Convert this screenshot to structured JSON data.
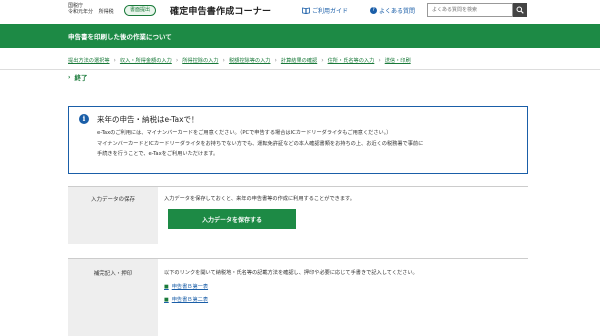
{
  "header": {
    "org_name": "国税庁",
    "year": "令和元年分",
    "tax_type": "所得税",
    "mode_badge": "書面提出",
    "site_title": "確定申告書作成コーナー",
    "guide_link": "ご利用ガイド",
    "faq_link": "よくある質問",
    "search_placeholder": "よくある質問を検索"
  },
  "banner": {
    "title": "申告書を印刷した後の作業について"
  },
  "steps": [
    "提出方法の選択等",
    "収入・所得金額の入力",
    "所得控除の入力",
    "税額控除等の入力",
    "計算結果の確認",
    "住所・氏名等の入力",
    "送信・印刷"
  ],
  "current_step": "終了",
  "info": {
    "title": "来年の申告・納税はe-Taxで！",
    "line1": "e-Taxのご利用には、マイナンバーカードをご用意ください。（PCで申告する場合はICカードリーダライタもご用意ください。）",
    "line2": "マイナンバーカードとICカードリーダライタをお持ちでない方でも、運転免許証などの本人確認書類をお持ちの上、お近くの税務署で事前に",
    "line3": "手続きを行うことで、e-Taxをご利用いただけます。"
  },
  "sections": {
    "save": {
      "label": "入力データの保存",
      "description": "入力データを保存しておくと、来年の申告書等の作成に利用することができます。",
      "button": "入力データを保存する"
    },
    "fill": {
      "label": "補完記入・押印",
      "description": "以下のリンクを開いて納税地・氏名等の記載方法を確認し、押印や必要に応じて手書きで記入してください。",
      "links": [
        "申告書Ｂ第一表",
        "申告書Ｂ第二表"
      ]
    }
  },
  "colors": {
    "brand_green": "#1d8a45",
    "link_blue": "#1a5ea8"
  }
}
